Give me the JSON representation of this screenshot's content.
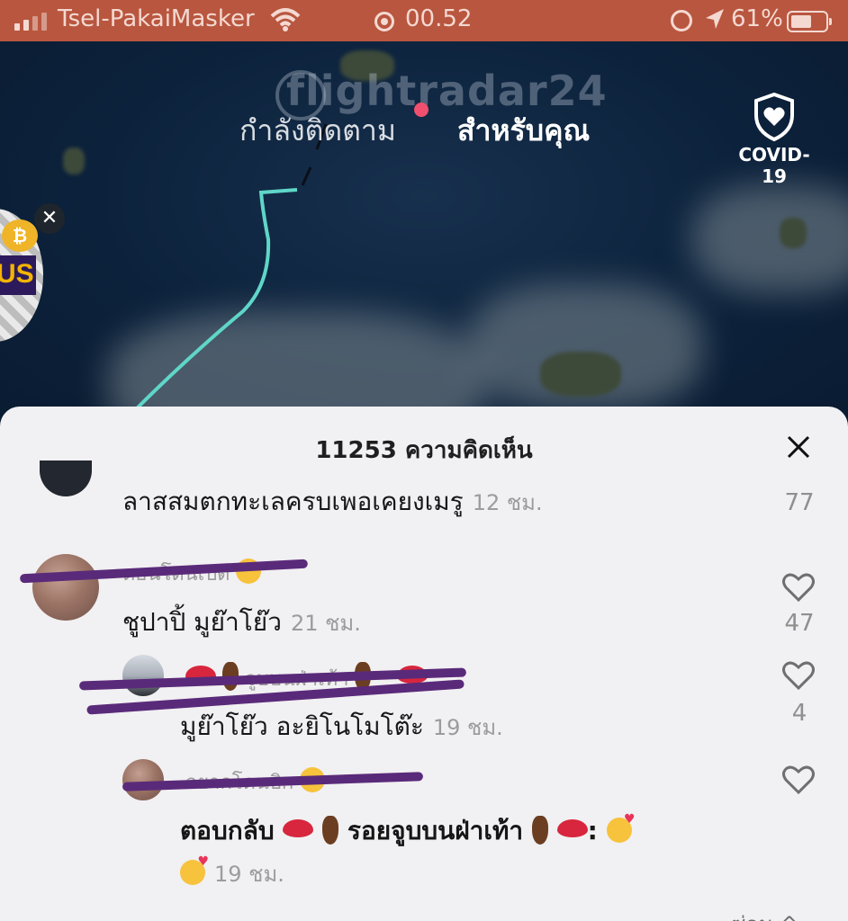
{
  "status_bar": {
    "carrier": "Tsel-PakaiMasker",
    "time": "00.52",
    "battery_pct": "61%",
    "battery_level": 0.61,
    "signal_bars": 2,
    "icons": [
      "signal-icon",
      "wifi-icon",
      "screen-record-icon",
      "orientation-lock-icon",
      "location-icon",
      "battery-icon"
    ]
  },
  "video": {
    "tabs": [
      {
        "label": "กำลังติดตาม",
        "active": false
      },
      {
        "label": "สำหรับคุณ",
        "active": true
      }
    ],
    "covid_label": "COVID-19",
    "promo_close": "✕",
    "promo_badge": "US",
    "colors": {
      "track": "#5fd6c8",
      "live_dot": "#f0506e"
    }
  },
  "comments_sheet": {
    "title": "11253 ความคิดเห็น",
    "close_icon": "close-icon",
    "more_label": "ซ่อน ^",
    "comments": [
      {
        "text": "ลาสสมตกทะเลครบเพอเคยงเมรู",
        "time": "12 ชม.",
        "likes": "77"
      },
      {
        "username": "ดอนโดนเปด",
        "text": "ชูปาปิ้ มูย๊าโย๊ว",
        "time": "21 ชม.",
        "likes": "47"
      },
      {
        "username": "จูบบนฝ่าเท้า",
        "text": "มูย๊าโย๊ว อะยิโนโมโต๊ะ",
        "time": "19 ชม.",
        "likes": "4"
      },
      {
        "username": "อยากโดนบิก",
        "reply_prefix": "ตอบกลับ",
        "reply_target": "รอยจูบบนฝ่าเท้า",
        "time": "19 ชม.",
        "likes": ""
      }
    ]
  }
}
